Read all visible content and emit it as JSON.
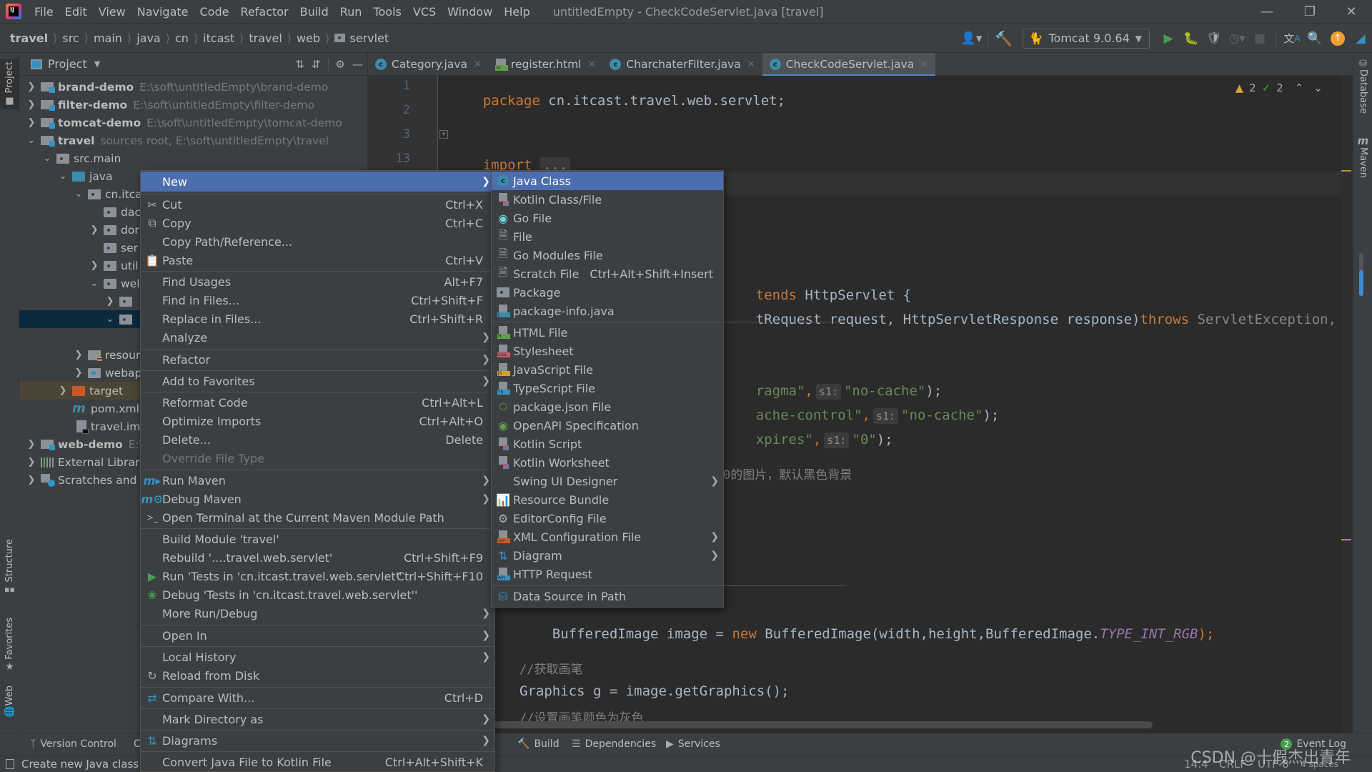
{
  "menubar": {
    "items": [
      "File",
      "Edit",
      "View",
      "Navigate",
      "Code",
      "Refactor",
      "Build",
      "Run",
      "Tools",
      "VCS",
      "Window",
      "Help"
    ],
    "window_title": "untitledEmpty - CheckCodeServlet.java [travel]"
  },
  "breadcrumb": [
    "travel",
    "src",
    "main",
    "java",
    "cn",
    "itcast",
    "travel",
    "web",
    "servlet"
  ],
  "toolbar": {
    "run_config": "Tomcat 9.0.64",
    "icons": [
      "user-icon",
      "build-hammer-icon",
      "run-icon",
      "debug-icon",
      "coverage-icon",
      "profile-icon",
      "stop-icon",
      "translate-icon",
      "search-icon",
      "update-icon",
      "plugin-icon"
    ]
  },
  "left_stripe": {
    "top": [
      "Project"
    ],
    "bottom": [
      "Structure",
      "Favorites",
      "Web"
    ]
  },
  "right_stripe": [
    "Database",
    "Maven"
  ],
  "project_panel": {
    "title": "Project",
    "tree": [
      {
        "label": "brand-demo",
        "hint": "E:\\soft\\untitledEmpty\\brand-demo"
      },
      {
        "label": "filter-demo",
        "hint": "E:\\soft\\untitledEmpty\\filter-demo"
      },
      {
        "label": "tomcat-demo",
        "hint": "E:\\soft\\untitledEmpty\\tomcat-demo"
      },
      {
        "label": "travel",
        "hint": "sources root,  E:\\soft\\untitledEmpty\\travel"
      },
      {
        "label": "src.main"
      },
      {
        "label": "java"
      },
      {
        "label": "cn.itca"
      },
      {
        "label": "dac"
      },
      {
        "label": "dor"
      },
      {
        "label": "ser"
      },
      {
        "label": "util"
      },
      {
        "label": "wel"
      },
      {
        "label": ""
      },
      {
        "label": ""
      },
      {
        "label": "resources"
      },
      {
        "label": "webapp"
      },
      {
        "label": "target"
      },
      {
        "label": "pom.xml"
      },
      {
        "label": "travel.iml"
      },
      {
        "label": "web-demo",
        "hint": "E:\\s"
      },
      {
        "label": "External Librarie"
      },
      {
        "label": "Scratches and C"
      }
    ]
  },
  "tabs": [
    {
      "label": "Category.java",
      "active": false
    },
    {
      "label": "register.html",
      "active": false
    },
    {
      "label": "CharchaterFilter.java",
      "active": false
    },
    {
      "label": "CheckCodeServlet.java",
      "active": true
    }
  ],
  "editor": {
    "line_numbers": [
      "1",
      "2",
      "3",
      "13"
    ],
    "inspection": {
      "warnings": "2",
      "weak_warnings": "2"
    },
    "code": {
      "l1_kw": "package",
      "l1_rest": " cn.itcast.travel.web.servlet;",
      "l3_kw": "import",
      "l3_collapsed": "...",
      "extends_kw": "tends",
      "extends_rest": " HttpServlet {",
      "sig_a": "tRequest request, HttpServletResponse response)",
      "sig_throws": "throws",
      "sig_b": " ServletException, IO",
      "h1_str": "ragma\"",
      "h1_hint": "s1:",
      "h1_val": "\"no-cache\"",
      "h2_str": "ache-control\"",
      "h2_hint": "s1:",
      "h2_val": "\"no-cache\"",
      "h3_str": "xpires\"",
      "h3_hint": "s1:",
      "h3_val": "\"0\"",
      "cmt1": "0的图片，默认黑色背景",
      "img_a": "BufferedImage image = ",
      "img_new": "new",
      "img_b": " BufferedImage(width,height,BufferedImage.",
      "img_const": "TYPE_INT_RGB",
      "img_end": ");",
      "cmt2": "//获取画笔",
      "gfx": "Graphics g = image.getGraphics();",
      "cmt3": "//设置画笔颜色为灰色"
    }
  },
  "context_menu": {
    "items": [
      {
        "label": "New",
        "arrow": true,
        "highlighted": true
      },
      {
        "label": "Cut",
        "shortcut": "Ctrl+X",
        "icon": "scissors-icon"
      },
      {
        "label": "Copy",
        "shortcut": "Ctrl+C",
        "icon": "copy-icon"
      },
      {
        "label": "Copy Path/Reference..."
      },
      {
        "label": "Paste",
        "shortcut": "Ctrl+V",
        "icon": "paste-icon"
      },
      {
        "label": "Find Usages",
        "shortcut": "Alt+F7"
      },
      {
        "label": "Find in Files...",
        "shortcut": "Ctrl+Shift+F"
      },
      {
        "label": "Replace in Files...",
        "shortcut": "Ctrl+Shift+R"
      },
      {
        "label": "Analyze",
        "arrow": true
      },
      {
        "label": "Refactor",
        "arrow": true
      },
      {
        "label": "Add to Favorites",
        "arrow": true
      },
      {
        "label": "Reformat Code",
        "shortcut": "Ctrl+Alt+L"
      },
      {
        "label": "Optimize Imports",
        "shortcut": "Ctrl+Alt+O"
      },
      {
        "label": "Delete...",
        "shortcut": "Delete"
      },
      {
        "label": "Override File Type",
        "disabled": true
      },
      {
        "label": "Run Maven",
        "arrow": true,
        "icon": "maven-run-icon"
      },
      {
        "label": "Debug Maven",
        "arrow": true,
        "icon": "maven-debug-icon"
      },
      {
        "label": "Open Terminal at the Current Maven Module Path",
        "icon": "terminal-maven-icon"
      },
      {
        "label": "Build Module 'travel'"
      },
      {
        "label": "Rebuild '....travel.web.servlet'",
        "shortcut": "Ctrl+Shift+F9"
      },
      {
        "label": "Run 'Tests in 'cn.itcast.travel.web.servlet''",
        "shortcut": "Ctrl+Shift+F10",
        "icon": "run-icon"
      },
      {
        "label": "Debug 'Tests in 'cn.itcast.travel.web.servlet''",
        "icon": "debug-icon"
      },
      {
        "label": "More Run/Debug",
        "arrow": true
      },
      {
        "label": "Open In",
        "arrow": true
      },
      {
        "label": "Local History",
        "arrow": true
      },
      {
        "label": "Reload from Disk",
        "icon": "reload-icon"
      },
      {
        "label": "Compare With...",
        "shortcut": "Ctrl+D",
        "icon": "compare-icon"
      },
      {
        "label": "Mark Directory as",
        "arrow": true
      },
      {
        "label": "Diagrams",
        "arrow": true,
        "icon": "diagram-icon"
      },
      {
        "label": "Convert Java File to Kotlin File",
        "shortcut": "Ctrl+Alt+Shift+K"
      }
    ]
  },
  "new_submenu": {
    "items": [
      {
        "label": "Java Class",
        "highlighted": true
      },
      {
        "label": "Kotlin Class/File"
      },
      {
        "label": "Go File"
      },
      {
        "label": "File"
      },
      {
        "label": "Go Modules File"
      },
      {
        "label": "Scratch File",
        "shortcut": "Ctrl+Alt+Shift+Insert"
      },
      {
        "label": "Package"
      },
      {
        "label": "package-info.java"
      },
      {
        "label": "HTML File"
      },
      {
        "label": "Stylesheet"
      },
      {
        "label": "JavaScript File"
      },
      {
        "label": "TypeScript File"
      },
      {
        "label": "package.json File"
      },
      {
        "label": "OpenAPI Specification"
      },
      {
        "label": "Kotlin Script"
      },
      {
        "label": "Kotlin Worksheet"
      },
      {
        "label": "Swing UI Designer",
        "arrow": true
      },
      {
        "label": "Resource Bundle"
      },
      {
        "label": "EditorConfig File"
      },
      {
        "label": "XML Configuration File",
        "arrow": true
      },
      {
        "label": "Diagram",
        "arrow": true
      },
      {
        "label": "HTTP Request"
      },
      {
        "label": "Data Source in Path"
      }
    ]
  },
  "toolwindow_bar": {
    "left": [
      "Version Control",
      "C"
    ],
    "middle": [
      "Build",
      "Dependencies",
      "Services"
    ],
    "event_log": {
      "label": "Event Log",
      "count": "2"
    }
  },
  "status_bar": {
    "message": "Create new Java class",
    "position": "14:4",
    "line_sep": "CRLF",
    "encoding": "UTF-8",
    "indent": "4 spaces"
  },
  "watermark": "CSDN @十假杰出青年",
  "colors": {
    "accent": "#4b6eaf",
    "tab_underline": "#4a88c7",
    "keyword": "#cc7832",
    "string": "#6a8759",
    "constant": "#9876aa"
  }
}
